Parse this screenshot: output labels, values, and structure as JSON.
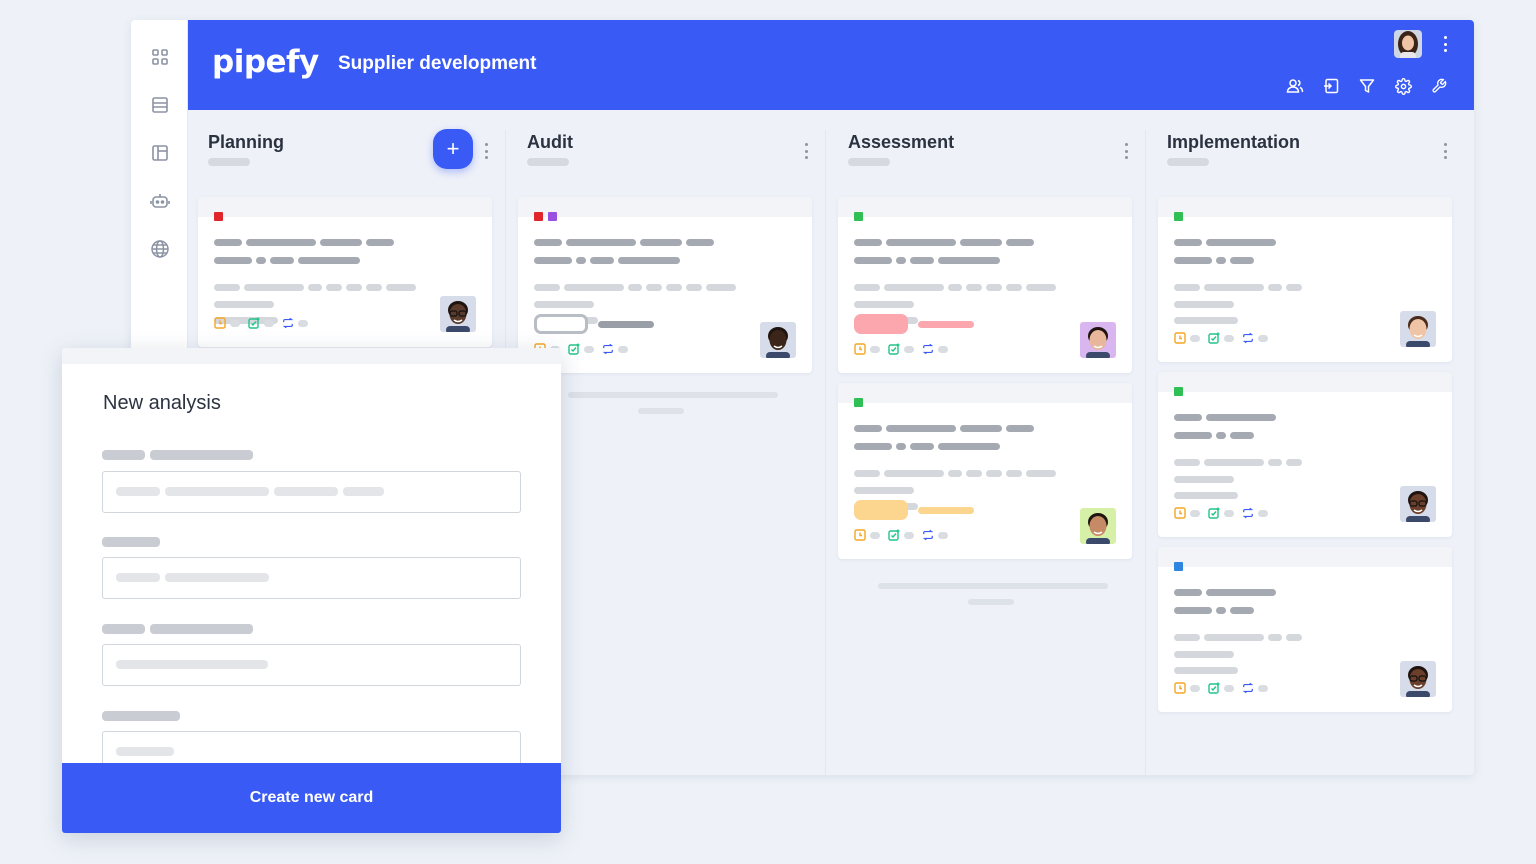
{
  "app": {
    "logo": "pipefy",
    "pipe_title": "Supplier development"
  },
  "sidebar": {
    "items": [
      {
        "icon": "apps-grid-icon"
      },
      {
        "icon": "list-view-icon"
      },
      {
        "icon": "table-view-icon"
      },
      {
        "icon": "automation-robot-icon"
      },
      {
        "icon": "globe-icon"
      }
    ]
  },
  "header_tools": [
    "members-icon",
    "import-icon",
    "filter-icon",
    "settings-gear-icon",
    "wrench-icon"
  ],
  "phases": [
    {
      "title": "Planning",
      "has_add_button": true,
      "add_label": "+"
    },
    {
      "title": "Audit"
    },
    {
      "title": "Assessment"
    },
    {
      "title": "Implementation"
    }
  ],
  "colors": {
    "brand": "#3a5af5",
    "label_red": "#e0252b",
    "label_purple": "#9b4fe0",
    "label_green": "#2fbf55",
    "label_blue": "#2f86e0",
    "tag_red": "#fba7ad",
    "tag_orange": "#fcd58e",
    "icon_orange": "#f5a623",
    "icon_green": "#22c48a",
    "icon_blue": "#3a5af5"
  },
  "modal": {
    "title": "New analysis",
    "submit_label": "Create new card"
  }
}
